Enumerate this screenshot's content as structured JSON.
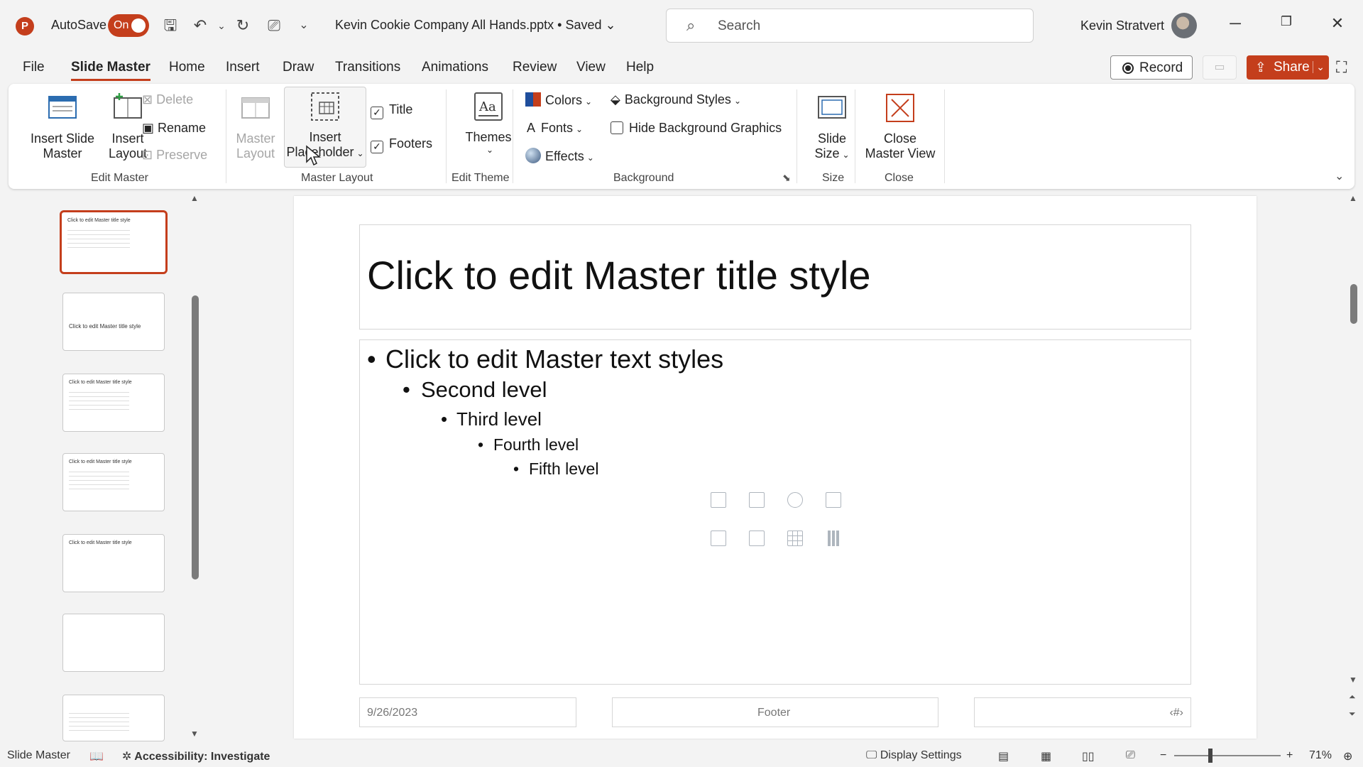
{
  "titlebar": {
    "app_icon_letter": "P",
    "autosave_label": "AutoSave",
    "autosave_state": "On",
    "filename": "Kevin Cookie Company All Hands.pptx • Saved ⌄",
    "search_placeholder": "Search",
    "user_name": "Kevin Stratvert",
    "icons": [
      "save-icon",
      "undo-icon",
      "redo-icon",
      "present-icon",
      "customize-icon",
      "minimize-icon",
      "restore-icon",
      "close-icon"
    ]
  },
  "menu": {
    "tabs": [
      "File",
      "Slide Master",
      "Home",
      "Insert",
      "Draw",
      "Transitions",
      "Animations",
      "Review",
      "View",
      "Help"
    ],
    "active_tab": "Slide Master",
    "record_label": "Record",
    "share_label": "Share"
  },
  "ribbon": {
    "insert_slide_master": [
      "Insert Slide",
      "Master"
    ],
    "insert_layout": [
      "Insert",
      "Layout"
    ],
    "delete": "Delete",
    "rename": "Rename",
    "preserve": "Preserve",
    "edit_master_group": "Edit Master",
    "master_layout_btn": [
      "Master",
      "Layout"
    ],
    "insert_placeholder": [
      "Insert",
      "Placeholder"
    ],
    "title_checkbox": "Title",
    "footers_checkbox": "Footers",
    "master_layout_group": "Master Layout",
    "themes": "Themes",
    "edit_theme_group": "Edit Theme",
    "colors": "Colors",
    "fonts": "Fonts",
    "effects": "Effects",
    "background_styles": "Background Styles",
    "hide_background_graphics": "Hide Background Graphics",
    "background_group": "Background",
    "slide_size": [
      "Slide",
      "Size"
    ],
    "size_group": "Size",
    "close_master_view": [
      "Close",
      "Master View"
    ],
    "close_group": "Close"
  },
  "slide": {
    "title": "Click to edit Master title style",
    "levels": [
      "Click to edit Master text styles",
      "Second level",
      "Third level",
      "Fourth level",
      "Fifth level"
    ],
    "date": "9/26/2023",
    "footer": "Footer",
    "page_number": "‹#›"
  },
  "thumbnails": {
    "title_text": "Click to edit Master title style"
  },
  "statusbar": {
    "mode": "Slide Master",
    "accessibility": "Accessibility: Investigate",
    "display_settings": "Display Settings",
    "zoom": "71%"
  },
  "colors": {
    "accent": "#c43e1c"
  }
}
